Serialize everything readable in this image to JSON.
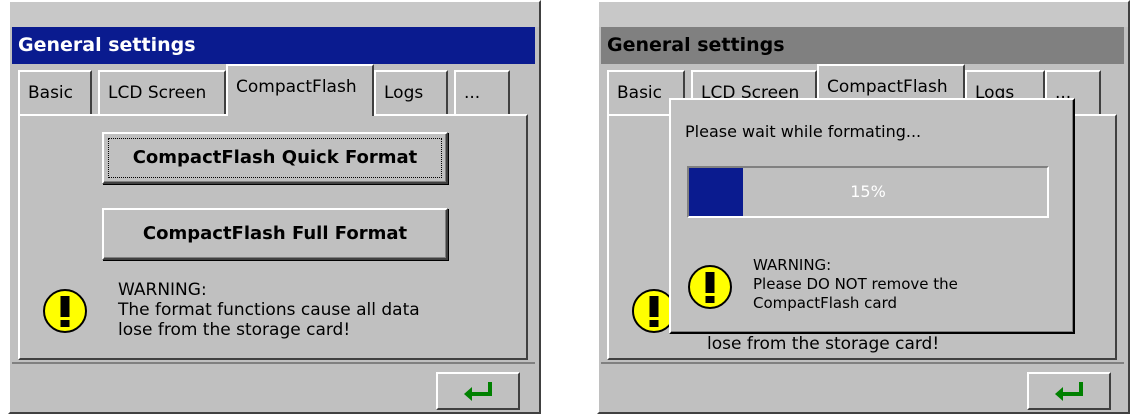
{
  "left_window": {
    "title": "General settings",
    "tabs": [
      "Basic",
      "LCD Screen",
      "CompactFlash",
      "Logs",
      "..."
    ],
    "active_tab": "CompactFlash",
    "quick_format_label": "CompactFlash Quick Format",
    "full_format_label": "CompactFlash Full Format",
    "warning_text": "WARNING:\nThe format functions cause all data\nlose from the storage card!",
    "ok_icon": "enter-arrow-icon"
  },
  "right_window": {
    "title": "General settings",
    "tabs": [
      "Basic",
      "LCD Screen",
      "CompactFlash",
      "Logs",
      "..."
    ],
    "active_tab": "CompactFlash",
    "background_warning_fragment": "lose from the storage card!",
    "ok_icon": "enter-arrow-icon",
    "dialog": {
      "message": "Please wait while formating...",
      "progress_percent": 15,
      "progress_label": "15%",
      "warning_text": "WARNING:\nPlease DO NOT remove the\nCompactFlash card"
    }
  },
  "colors": {
    "title_active": "#0a1b8f",
    "title_inactive": "#808080",
    "face": "#c0c0c0",
    "warning_yellow": "#ffff00",
    "ok_arrow": "#008000"
  }
}
